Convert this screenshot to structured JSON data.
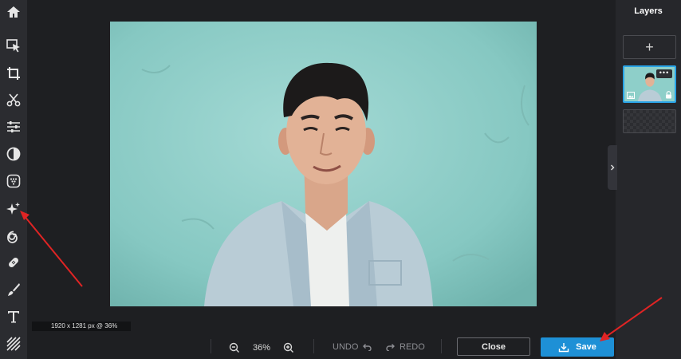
{
  "toolbar": {
    "items": [
      {
        "name": "home-icon"
      },
      {
        "name": "select-icon"
      },
      {
        "name": "crop-icon"
      },
      {
        "name": "cutout-icon"
      },
      {
        "name": "adjust-icon"
      },
      {
        "name": "filter-icon"
      },
      {
        "name": "effects-icon"
      },
      {
        "name": "sparkle-icon"
      },
      {
        "name": "liquify-icon"
      },
      {
        "name": "retouch-icon"
      },
      {
        "name": "paint-icon"
      },
      {
        "name": "text-icon"
      },
      {
        "name": "pattern-icon"
      }
    ]
  },
  "canvas": {
    "dimensions_label": "1920 x 1281 px @ 36%"
  },
  "layers_panel": {
    "title": "Layers",
    "add_label": "+",
    "more_label": "•••"
  },
  "bottom_bar": {
    "zoom_value": "36%",
    "undo_label": "UNDO",
    "redo_label": "REDO",
    "close_label": "Close",
    "save_label": "Save"
  },
  "colors": {
    "accent": "#1e90d6",
    "annotation_arrow": "#e02424",
    "photo_background": "#8ecfc9"
  }
}
